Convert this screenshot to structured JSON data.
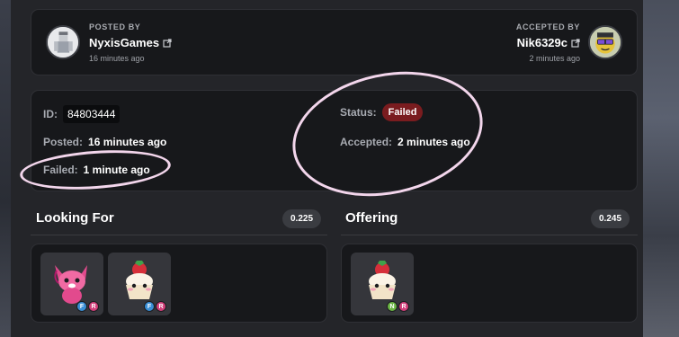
{
  "posted_by": {
    "role": "POSTED BY",
    "name": "NyxisGames",
    "time": "16 minutes ago"
  },
  "accepted_by": {
    "role": "ACCEPTED BY",
    "name": "Nik6329c",
    "time": "2 minutes ago"
  },
  "trade": {
    "id_label": "ID:",
    "id_value": "84803444",
    "status_label": "Status:",
    "status_value": "Failed",
    "posted_label": "Posted:",
    "posted_value": "16 minutes ago",
    "accepted_label": "Accepted:",
    "accepted_value": "2 minutes ago",
    "failed_label": "Failed:",
    "failed_value": "1 minute ago"
  },
  "looking_for": {
    "title": "Looking For",
    "value": "0.225",
    "items": [
      {
        "pet": "pink-fox-pet",
        "tags": [
          "F",
          "R"
        ]
      },
      {
        "pet": "strawberry-shortcake-pet",
        "tags": [
          "F",
          "R"
        ]
      }
    ]
  },
  "offering": {
    "title": "Offering",
    "value": "0.245",
    "items": [
      {
        "pet": "strawberry-shortcake-pet",
        "tags": [
          "N",
          "R"
        ]
      }
    ]
  },
  "colors": {
    "status_failed": "#7a1c1f",
    "annotation": "#f3d6ec",
    "tag_fly": "#3a8fd6",
    "tag_ride": "#d23f7a",
    "tag_neon": "#6bb544"
  }
}
